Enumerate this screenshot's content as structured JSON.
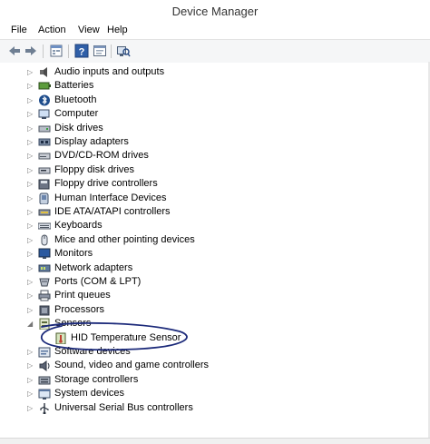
{
  "window": {
    "title": "Device Manager"
  },
  "menu": {
    "file": "File",
    "action": "Action",
    "view": "View",
    "help": "Help"
  },
  "toolbar": {
    "buttons": [
      "back-arrow-icon",
      "forward-arrow-icon",
      "properties-icon",
      "help-icon",
      "refresh-view-icon",
      "scan-hardware-icon"
    ]
  },
  "tree": {
    "categories": [
      {
        "label": "Audio inputs and outputs",
        "icon": "speaker-icon"
      },
      {
        "label": "Batteries",
        "icon": "battery-icon"
      },
      {
        "label": "Bluetooth",
        "icon": "bluetooth-icon"
      },
      {
        "label": "Computer",
        "icon": "computer-icon"
      },
      {
        "label": "Disk drives",
        "icon": "disk-drive-icon"
      },
      {
        "label": "Display adapters",
        "icon": "display-adapter-icon"
      },
      {
        "label": "DVD/CD-ROM drives",
        "icon": "dvd-drive-icon"
      },
      {
        "label": "Floppy disk drives",
        "icon": "floppy-drive-icon"
      },
      {
        "label": "Floppy drive controllers",
        "icon": "floppy-controller-icon"
      },
      {
        "label": "Human Interface Devices",
        "icon": "hid-icon"
      },
      {
        "label": "IDE ATA/ATAPI controllers",
        "icon": "ide-controller-icon"
      },
      {
        "label": "Keyboards",
        "icon": "keyboard-icon"
      },
      {
        "label": "Mice and other pointing devices",
        "icon": "mouse-icon"
      },
      {
        "label": "Monitors",
        "icon": "monitor-icon"
      },
      {
        "label": "Network adapters",
        "icon": "network-adapter-icon"
      },
      {
        "label": "Ports (COM & LPT)",
        "icon": "port-icon"
      },
      {
        "label": "Print queues",
        "icon": "printer-icon"
      },
      {
        "label": "Processors",
        "icon": "processor-icon"
      },
      {
        "label": "Sensors",
        "icon": "sensor-icon",
        "expanded": true
      },
      {
        "label": "HID Temperature Sensor",
        "icon": "temperature-sensor-icon",
        "child": true
      },
      {
        "label": "Software devices",
        "icon": "software-device-icon"
      },
      {
        "label": "Sound, video and game controllers",
        "icon": "sound-controller-icon"
      },
      {
        "label": "Storage controllers",
        "icon": "storage-controller-icon"
      },
      {
        "label": "System devices",
        "icon": "system-device-icon"
      },
      {
        "label": "Universal Serial Bus controllers",
        "icon": "usb-icon"
      }
    ]
  },
  "annotation": {
    "color": "#1c2a7a"
  }
}
